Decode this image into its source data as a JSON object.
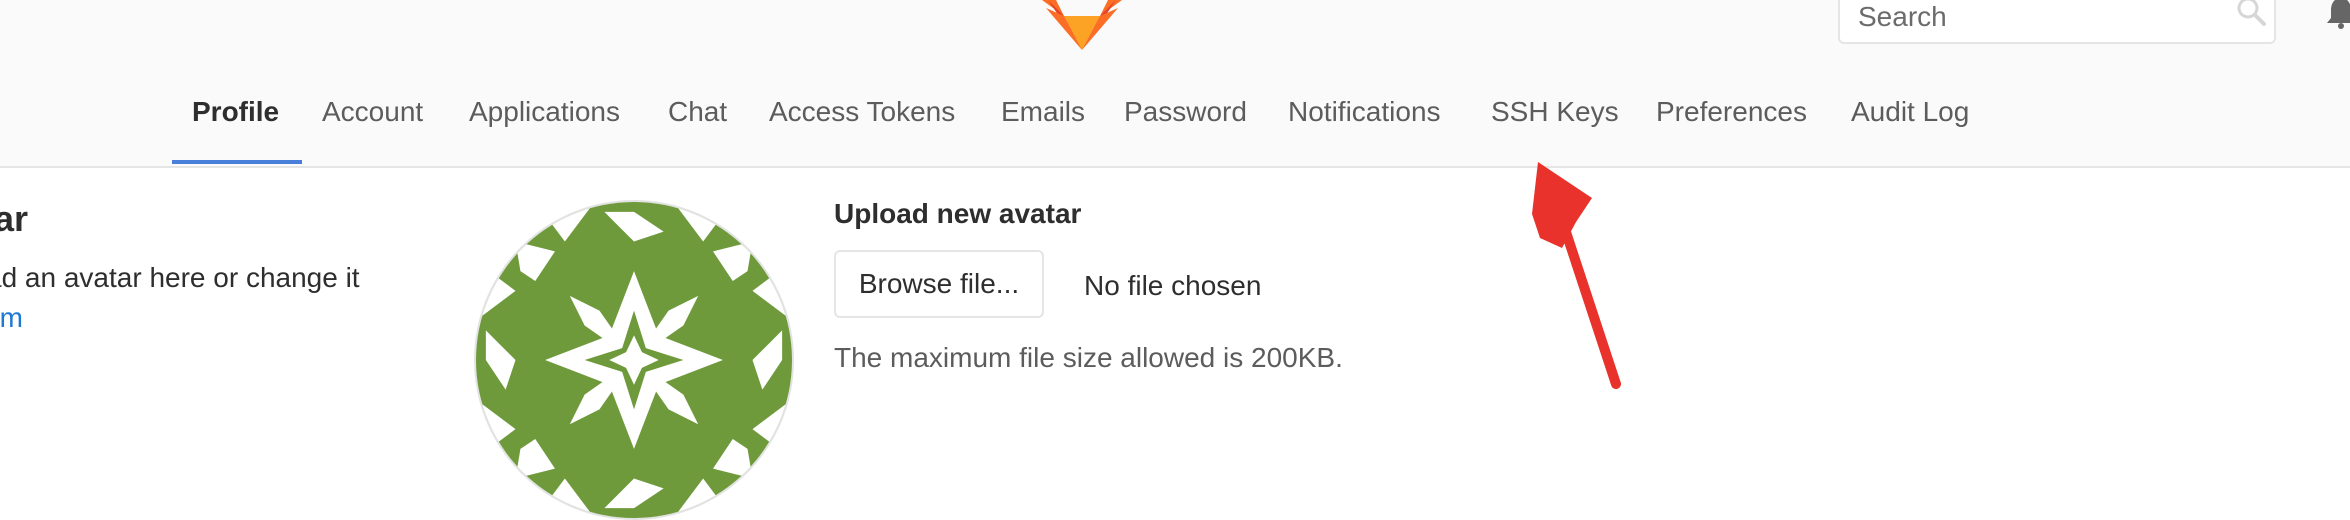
{
  "header": {
    "search": {
      "placeholder": "Search",
      "value": ""
    },
    "logo_icon": "gitlab-tanuki-logo",
    "notification_icon": "bell-icon"
  },
  "nav": {
    "tabs": [
      {
        "label": "Profile",
        "active": true
      },
      {
        "label": "Account"
      },
      {
        "label": "Applications"
      },
      {
        "label": "Chat"
      },
      {
        "label": "Access Tokens"
      },
      {
        "label": "Emails"
      },
      {
        "label": "Password"
      },
      {
        "label": "Notifications"
      },
      {
        "label": "SSH Keys"
      },
      {
        "label": "Preferences"
      },
      {
        "label": "Audit Log"
      }
    ],
    "active_color": "#4a7fd9"
  },
  "avatar_section": {
    "title": "atar",
    "description": "ad an avatar here or change it",
    "link": "om"
  },
  "upload": {
    "title": "Upload new avatar",
    "browse_label": "Browse file...",
    "file_status": "No file chosen",
    "hint": "The maximum file size allowed is 200KB."
  },
  "colors": {
    "avatar_green": "#6f9a3c",
    "annotation_arrow": "#e8322b",
    "link": "#1f78d1"
  }
}
